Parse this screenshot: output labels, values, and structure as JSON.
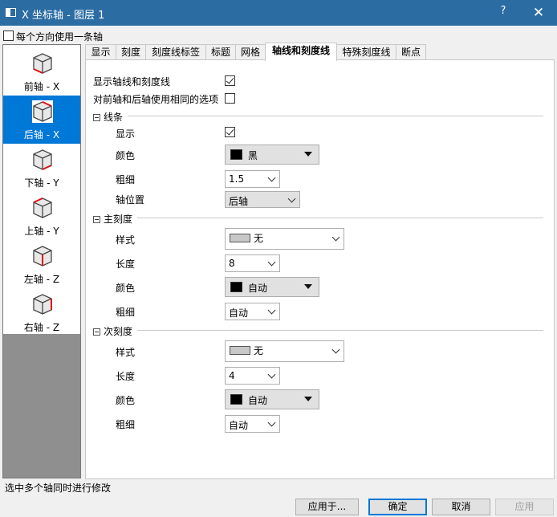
{
  "window": {
    "title": "X 坐标轴 - 图层 1",
    "help_label": "?",
    "close_label": "✕"
  },
  "top_option": {
    "label": "每个方向使用一条轴",
    "checked": false
  },
  "axis_list": [
    {
      "label": "前轴 - X",
      "icon": "cube-front-axis-icon"
    },
    {
      "label": "后轴 - X",
      "icon": "cube-back-axis-icon"
    },
    {
      "label": "下轴 - Y",
      "icon": "cube-bottom-axis-icon"
    },
    {
      "label": "上轴 - Y",
      "icon": "cube-top-axis-icon"
    },
    {
      "label": "左轴 - Z",
      "icon": "cube-left-axis-icon"
    },
    {
      "label": "右轴 - Z",
      "icon": "cube-right-axis-icon"
    }
  ],
  "selected_axis": "后轴 - X",
  "tabs": [
    "显示",
    "刻度",
    "刻度线标签",
    "标题",
    "网格",
    "轴线和刻度线",
    "特殊刻度线",
    "断点"
  ],
  "active_tab": "轴线和刻度线",
  "panel": {
    "show_axis_label": "显示轴线和刻度线",
    "same_options_label": "对前轴和后轴使用相同的选项",
    "line": {
      "header": "线条",
      "show_label": "显示",
      "color_label": "颜色",
      "color_value": "黑",
      "color_hex": "#000000",
      "thickness_label": "粗细",
      "thickness_value": "1.5",
      "position_label": "轴位置",
      "position_value": "后轴"
    },
    "major": {
      "header": "主刻度",
      "style_label": "样式",
      "style_value": "无",
      "length_label": "长度",
      "length_value": "8",
      "color_label": "颜色",
      "color_value": "自动",
      "color_hex": "#000000",
      "thickness_label": "粗细",
      "thickness_value": "自动"
    },
    "minor": {
      "header": "次刻度",
      "style_label": "样式",
      "style_value": "无",
      "length_label": "长度",
      "length_value": "4",
      "color_label": "颜色",
      "color_value": "自动",
      "color_hex": "#000000",
      "thickness_label": "粗细",
      "thickness_value": "自动"
    }
  },
  "status_text": "选中多个轴同时进行修改",
  "buttons": {
    "apply_to": "应用于...",
    "ok": "确定",
    "cancel": "取消",
    "apply": "应用"
  },
  "colors": {
    "titlebar": "#2b6ca3",
    "selection": "#0078d7",
    "axis_highlight": "#e01010"
  }
}
